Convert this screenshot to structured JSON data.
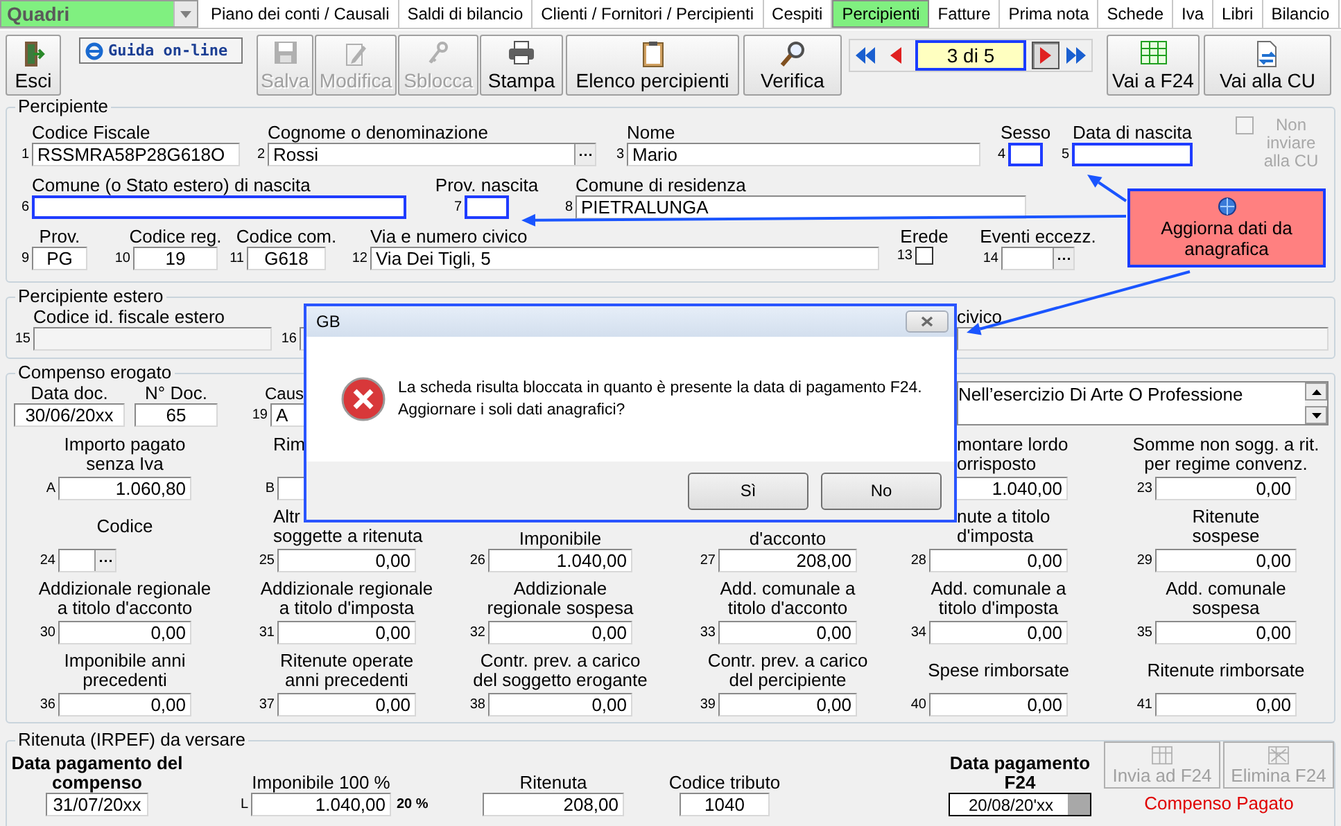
{
  "nav_bar": {
    "dropdown": "Quadri",
    "tabs": [
      {
        "label": "Piano dei conti / Causali",
        "selected": false
      },
      {
        "label": "Saldi di bilancio",
        "selected": false
      },
      {
        "label": "Clienti / Fornitori / Percipienti",
        "selected": false
      },
      {
        "label": "Cespiti",
        "selected": false
      },
      {
        "label": "Percipienti",
        "selected": true
      },
      {
        "label": "Fatture",
        "selected": false
      },
      {
        "label": "Prima nota",
        "selected": false
      },
      {
        "label": "Schede",
        "selected": false
      },
      {
        "label": "Iva",
        "selected": false
      },
      {
        "label": "Libri",
        "selected": false
      },
      {
        "label": "Bilancio",
        "selected": false
      }
    ]
  },
  "toolbar": {
    "buttons": [
      {
        "kind": "exit",
        "label": "Esci",
        "disabled": false
      },
      {
        "kind": "help",
        "label": "Guida on-line",
        "disabled": false
      },
      {
        "kind": "save",
        "label": "Salva",
        "disabled": true
      },
      {
        "kind": "edit",
        "label": "Modifica",
        "disabled": true
      },
      {
        "kind": "unlock",
        "label": "Sblocca",
        "disabled": true
      },
      {
        "kind": "print",
        "label": "Stampa",
        "disabled": false
      },
      {
        "kind": "list",
        "label": "Elenco percipienti",
        "disabled": false
      },
      {
        "kind": "verify",
        "label": "Verifica",
        "disabled": false
      }
    ],
    "pager": {
      "record": "3 di 5",
      "buttons": [
        {
          "kind": "first",
          "pressed": false
        },
        {
          "kind": "prev",
          "pressed": false
        },
        {
          "kind": "next",
          "pressed": true
        },
        {
          "kind": "last",
          "pressed": false
        }
      ]
    },
    "links": [
      {
        "kind": "f24",
        "label": "Vai a F24"
      },
      {
        "kind": "cu",
        "label": "Vai alla CU"
      }
    ]
  },
  "percipiente": {
    "title": "Percipiente",
    "lines": [
      {
        "fields": [
          {
            "kind": "text",
            "num": "1",
            "label": "Codice Fiscale",
            "value": "RSSMRA58P28G618O",
            "highlighted": false
          },
          {
            "kind": "lookup",
            "num": "2",
            "label": "Cognome o denominazione",
            "value": "Rossi",
            "highlighted": false
          },
          {
            "kind": "text",
            "num": "3",
            "label": "Nome",
            "value": "Mario",
            "highlighted": false
          },
          {
            "kind": "text",
            "num": "4",
            "label": "Sesso",
            "highlighted": true
          },
          {
            "kind": "text",
            "num": "5",
            "label": "Data di nascita",
            "highlighted": true
          }
        ]
      },
      {
        "fields": [
          {
            "kind": "text",
            "num": "6",
            "label": "Comune (o Stato estero) di nascita",
            "highlighted": true
          },
          {
            "kind": "text",
            "num": "7",
            "label": "Prov. nascita",
            "highlighted": true
          },
          {
            "kind": "text",
            "num": "8",
            "label": "Comune di residenza",
            "value": "PIETRALUNGA",
            "highlighted": false
          }
        ]
      },
      {
        "fields": [
          {
            "kind": "text",
            "num": "9",
            "label": "Prov.",
            "value": "PG",
            "highlighted": false
          },
          {
            "kind": "text",
            "num": "10",
            "label": "Codice reg.",
            "value": "19",
            "highlighted": false
          },
          {
            "kind": "text",
            "num": "11",
            "label": "Codice com.",
            "value": "G618",
            "highlighted": false
          },
          {
            "kind": "text",
            "num": "12",
            "label": "Via e numero civico",
            "value": "Via Dei Tigli, 5",
            "highlighted": false
          },
          {
            "kind": "check",
            "num": "13",
            "label": "Erede",
            "checked": false
          },
          {
            "kind": "lookup",
            "num": "14",
            "label": "Eventi eccezz.",
            "highlighted": false
          }
        ]
      }
    ],
    "opt_out": {
      "label": "Non inviare alla CU",
      "checked": false,
      "disabled": true
    }
  },
  "estero": {
    "title": "Percipiente estero",
    "fields": [
      {
        "num": "15",
        "label": "Codice id. fiscale estero"
      },
      {
        "num": "16"
      },
      {
        "label": "civico"
      }
    ]
  },
  "compenso": {
    "title": "Compenso erogato",
    "head": [
      {
        "label": "Data doc.",
        "value": "30/06/20xx"
      },
      {
        "label": "N° Doc.",
        "value": "65"
      },
      {
        "num": "19",
        "label": "Caus",
        "value": "A"
      }
    ],
    "causale_text": "Nell’esercizio Di Arte O Professione",
    "rows": [
      [
        {
          "kind": "normal",
          "num": "A",
          "label": "Importo pagato\nsenza Iva",
          "value": "1.060,80"
        },
        {
          "kind": "cut_left",
          "num": "B",
          "label": "Rim"
        },
        "",
        "",
        {
          "kind": "cut_right",
          "label": "montare lordo\norrisposto",
          "value": "1.040,00"
        },
        {
          "kind": "normal",
          "num": "23",
          "label": "Somme non sogg. a rit.\nper regime convenz.",
          "value": "0,00"
        }
      ],
      [
        {
          "kind": "lookup",
          "num": "24",
          "label": "Codice"
        },
        {
          "kind": "cut_left",
          "num": "25",
          "label": "Altr\nsoggette a ritenuta",
          "value": "0,00"
        },
        {
          "kind": "cut_top",
          "num": "26",
          "label": "Imponibile",
          "value": "1.040,00"
        },
        {
          "kind": "cut_top",
          "num": "27",
          "label": "d'acconto",
          "value": "208,00"
        },
        {
          "kind": "cut_right",
          "num": "28",
          "label": "nute a titolo\nd'imposta",
          "value": "0,00"
        },
        {
          "kind": "normal",
          "num": "29",
          "label": "Ritenute\nsospese",
          "value": "0,00"
        }
      ],
      [
        {
          "kind": "normal",
          "num": "30",
          "label": "Addizionale regionale\na titolo d'acconto",
          "value": "0,00"
        },
        {
          "kind": "normal",
          "num": "31",
          "label": "Addizionale regionale\na titolo d'imposta",
          "value": "0,00"
        },
        {
          "kind": "normal",
          "num": "32",
          "label": "Addizionale\nregionale sospesa",
          "value": "0,00"
        },
        {
          "kind": "normal",
          "num": "33",
          "label": "Add. comunale a\ntitolo d'acconto",
          "value": "0,00"
        },
        {
          "kind": "normal",
          "num": "34",
          "label": "Add. comunale a\ntitolo d'imposta",
          "value": "0,00"
        },
        {
          "kind": "normal",
          "num": "35",
          "label": "Add. comunale\nsospesa",
          "value": "0,00"
        }
      ],
      [
        {
          "kind": "normal",
          "num": "36",
          "label": "Imponibile anni\nprecedenti",
          "value": "0,00"
        },
        {
          "kind": "normal",
          "num": "37",
          "label": "Ritenute operate\nanni precedenti",
          "value": "0,00"
        },
        {
          "kind": "normal",
          "num": "38",
          "label": "Contr. prev. a carico\ndel soggetto erogante",
          "value": "0,00"
        },
        {
          "kind": "normal",
          "num": "39",
          "label": "Contr. prev. a carico\ndel percipiente",
          "value": "0,00"
        },
        {
          "kind": "normal",
          "num": "40",
          "label": "Spese rimborsate",
          "value": "0,00"
        },
        {
          "kind": "normal",
          "num": "41",
          "label": "Ritenute rimborsate",
          "value": "0,00"
        }
      ]
    ]
  },
  "ritenuta": {
    "title": "Ritenuta (IRPEF) da versare",
    "fields": [
      {
        "label": "Data pagamento del\ncompenso",
        "value": "31/07/20xx"
      },
      {
        "num": "L",
        "label": "Imponibile 100 %",
        "value": "1.040,00",
        "rate": "20 %"
      },
      {
        "label": "Ritenuta",
        "value": "208,00"
      },
      {
        "label": "Codice tributo",
        "value": "1040"
      },
      {
        "label": "Data pagamento\nF24",
        "value": "20/08/20'xx"
      }
    ],
    "actions": [
      {
        "kind": "send",
        "label": "Invia ad F24",
        "disabled": true
      },
      {
        "kind": "delete",
        "label": "Elimina F24",
        "disabled": true
      }
    ],
    "status": "Compenso Pagato"
  },
  "callout": {
    "text": "Aggiorna dati da anagrafica"
  },
  "dialog": {
    "title": "GB",
    "message": "La scheda risulta bloccata in quanto è presente la data di pagamento F24. Aggiornare i soli dati anagrafici?",
    "buttons": [
      "Sì",
      "No"
    ]
  }
}
